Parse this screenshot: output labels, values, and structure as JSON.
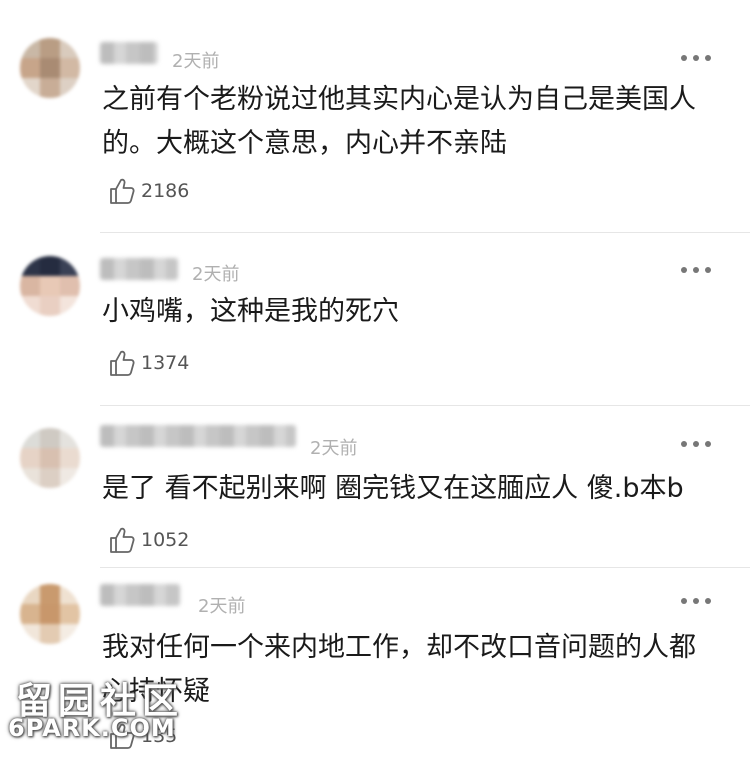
{
  "comments": [
    {
      "time": "2天前",
      "text": "之前有个老粉说过他其实内心是认为自己是美国人的。大概这个意思，内心并不亲陆",
      "likes": "2186"
    },
    {
      "time": "2天前",
      "text": "小鸡嘴，这种是我的死穴",
      "likes": "1374"
    },
    {
      "time": "2天前",
      "text": "是了 看不起别来啊 圈完钱又在这腼应人 傻.b本b",
      "likes": "1052"
    },
    {
      "time": "2天前",
      "text": "我对任何一个来内地工作，却不改口音问题的人都心持怀疑",
      "likes": "135"
    }
  ],
  "icons": {
    "like": "thumbs-up-icon",
    "more": "more-dots-icon"
  },
  "watermark": {
    "chinese": "留园社区",
    "latin": "6PARK.COM"
  }
}
